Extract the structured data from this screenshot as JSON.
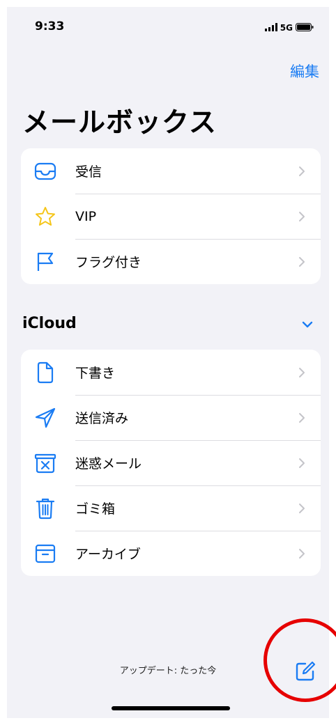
{
  "status_bar": {
    "time": "9:33",
    "network": "5G",
    "signal_icon": "cellular-signal-icon",
    "battery_icon": "battery-icon"
  },
  "header": {
    "edit_label": "編集",
    "title": "メールボックス"
  },
  "mailboxes": [
    {
      "label": "受信",
      "icon": "inbox-tray-icon"
    },
    {
      "label": "VIP",
      "icon": "star-icon"
    },
    {
      "label": "フラグ付き",
      "icon": "flag-icon"
    }
  ],
  "icloud": {
    "header": "iCloud",
    "toggle_icon": "chevron-down-icon",
    "items": [
      {
        "label": "下書き",
        "icon": "document-icon"
      },
      {
        "label": "送信済み",
        "icon": "paper-plane-icon"
      },
      {
        "label": "迷惑メール",
        "icon": "junk-tray-icon"
      },
      {
        "label": "ゴミ箱",
        "icon": "trash-icon"
      },
      {
        "label": "アーカイブ",
        "icon": "archive-box-icon"
      }
    ]
  },
  "toolbar": {
    "update_status": "アップデート: たった今",
    "compose_icon": "compose-icon"
  },
  "colors": {
    "accent": "#1a7cf3",
    "star": "#f5c518",
    "background": "#f2f2f7",
    "highlight": "#e60000"
  }
}
